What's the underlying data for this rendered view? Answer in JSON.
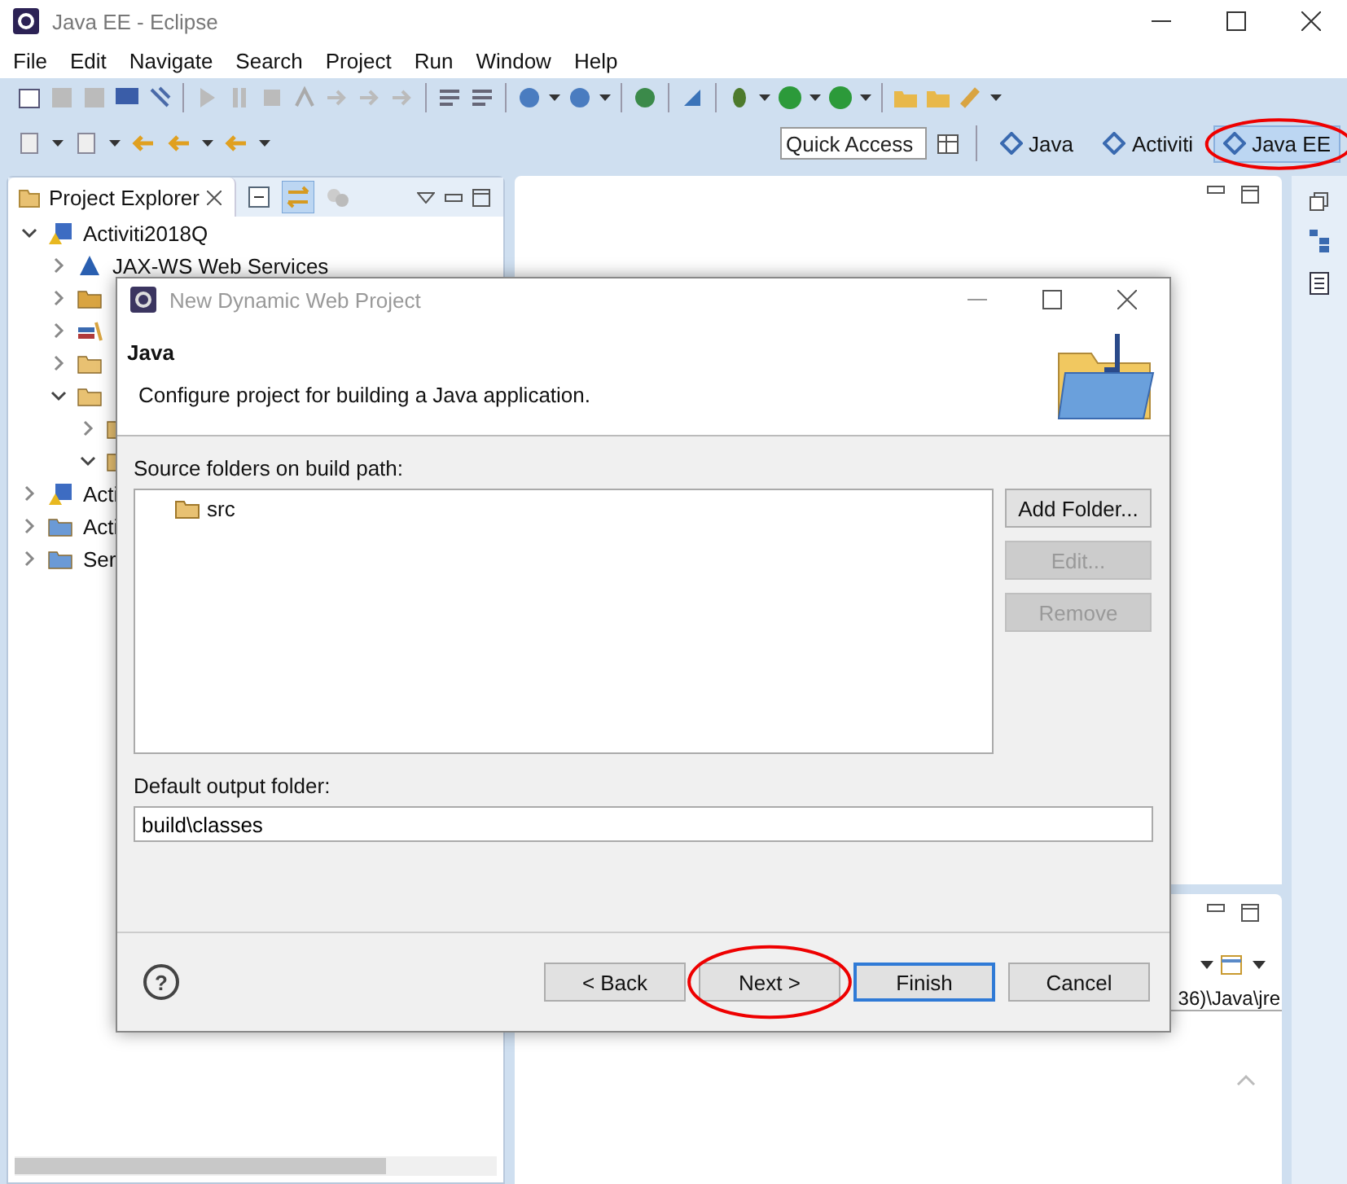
{
  "window": {
    "title": "Java EE - Eclipse"
  },
  "menu": [
    "File",
    "Edit",
    "Navigate",
    "Search",
    "Project",
    "Run",
    "Window",
    "Help"
  ],
  "quick_access": {
    "placeholder": "Quick Access"
  },
  "perspectives": [
    {
      "label": "Java",
      "selected": false,
      "highlighted": false
    },
    {
      "label": "Activiti",
      "selected": false,
      "highlighted": false
    },
    {
      "label": "Java EE",
      "selected": true,
      "highlighted": true
    }
  ],
  "project_explorer": {
    "title": "Project Explorer",
    "tree": [
      {
        "label": "Activiti2018Q",
        "kind": "project",
        "expanded": true,
        "children": [
          {
            "label": "JAX-WS Web Services",
            "kind": "service",
            "expanded": false
          },
          {
            "kind": "package",
            "expanded": false
          },
          {
            "kind": "library",
            "expanded": false
          },
          {
            "kind": "folder",
            "expanded": false
          },
          {
            "kind": "folder",
            "expanded": true,
            "children": [
              {
                "kind": "folder",
                "expanded": false
              },
              {
                "kind": "folder",
                "expanded": true
              }
            ]
          }
        ]
      },
      {
        "label": "Acti",
        "kind": "project",
        "expanded": false
      },
      {
        "label": "Acti",
        "kind": "openfolder",
        "expanded": false
      },
      {
        "label": "Ser",
        "kind": "openfolder",
        "expanded": false
      }
    ]
  },
  "console_panel": {
    "text": "36)\\Java\\jre"
  },
  "dialog": {
    "title": "New Dynamic Web Project",
    "heading": "Java",
    "description": "Configure project for building a Java application.",
    "source_label": "Source folders on build path:",
    "source_folders": [
      "src"
    ],
    "side_buttons": [
      {
        "label": "Add Folder...",
        "disabled": false
      },
      {
        "label": "Edit...",
        "disabled": true
      },
      {
        "label": "Remove",
        "disabled": true
      }
    ],
    "output_label": "Default output folder:",
    "output_folder": "build\\classes",
    "help": "?",
    "buttons": [
      {
        "label": "< Back",
        "default": false,
        "highlighted": false
      },
      {
        "label": "Next >",
        "default": false,
        "highlighted": true
      },
      {
        "label": "Finish",
        "default": true,
        "highlighted": false
      },
      {
        "label": "Cancel",
        "default": false,
        "highlighted": false
      }
    ]
  }
}
